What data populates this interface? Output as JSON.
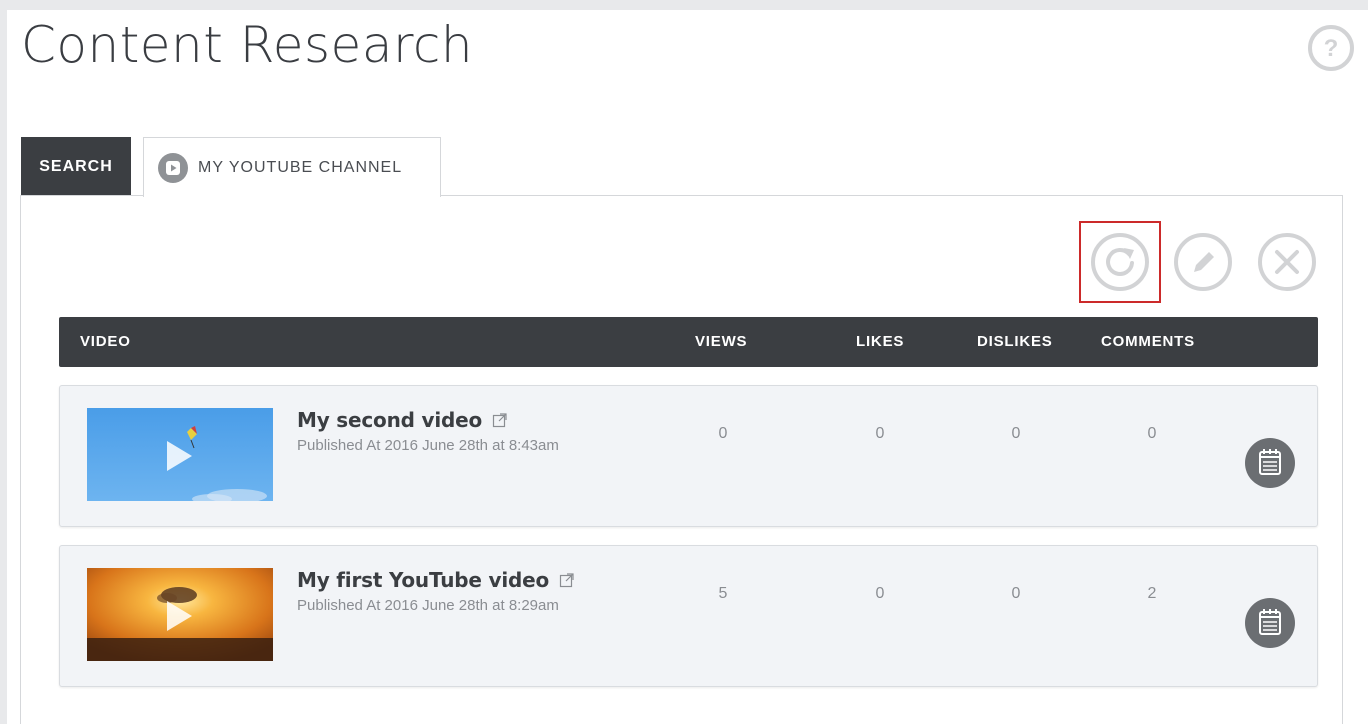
{
  "page": {
    "title": "Content Research"
  },
  "tabs": [
    {
      "label": "SEARCH",
      "active": false
    },
    {
      "label": "MY YOUTUBE CHANNEL",
      "active": true,
      "icon": "play-circle-icon"
    }
  ],
  "toolbar": {
    "buttons": [
      {
        "name": "refresh",
        "icon": "refresh-icon",
        "highlighted": true
      },
      {
        "name": "edit",
        "icon": "pencil-icon"
      },
      {
        "name": "delete",
        "icon": "close-icon"
      }
    ]
  },
  "table": {
    "columns": [
      "VIDEO",
      "VIEWS",
      "LIKES",
      "DISLIKES",
      "COMMENTS"
    ],
    "rows": [
      {
        "title": "My second video",
        "published": "Published At 2016 June 28th at 8:43am",
        "views": "0",
        "likes": "0",
        "dislikes": "0",
        "comments": "0",
        "thumbnail": "sky-kite"
      },
      {
        "title": "My first YouTube video",
        "published": "Published At 2016 June 28th at 8:29am",
        "views": "5",
        "likes": "0",
        "dislikes": "0",
        "comments": "2",
        "thumbnail": "sunset"
      }
    ]
  },
  "colors": {
    "dark": "#3b3e42",
    "highlight": "#cc2a2a",
    "icon_gray": "#d2d3d5",
    "row_bg": "#f2f4f7"
  }
}
